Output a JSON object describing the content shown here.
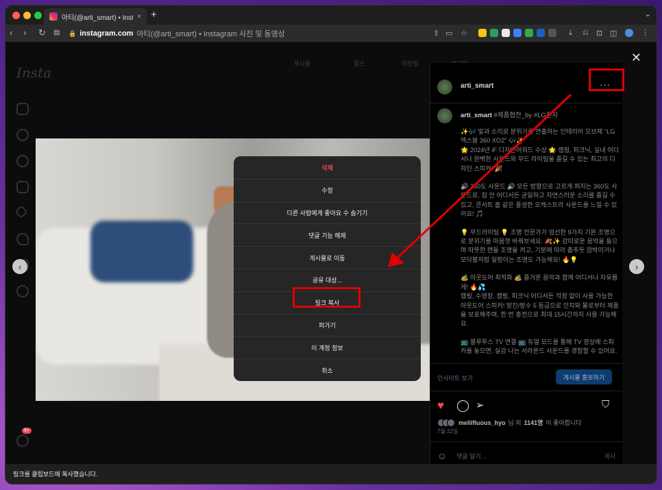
{
  "browser": {
    "tab_title": "아티(@arti_smart) • Instagram",
    "new_tab_label": "+",
    "url_domain": "instagram.com",
    "url_title": "아티(@arti_smart) • Instagram 사진 및 동영상"
  },
  "page": {
    "logo": "Insta",
    "top_tabs": [
      "게시물",
      "릴스",
      "저장됨",
      "태그됨"
    ],
    "notification_count": "9+"
  },
  "post": {
    "author": "arti_smart",
    "more_label": "···",
    "caption_author": "arti_smart",
    "caption_tags": "#제품협찬_by #LG전자",
    "caption_paragraphs": [
      "✨🎶 빛과 소리로 분위기를 연출하는 인테리어 오브제 \"LG 엑스붐 360 XO2\" 🎶✨\n🌟 2024년 iF 디자인어워드 수상 🌟 캠핑, 피크닉, 실내 어디서나 완벽한 사운드와 무드 라이팅을 즐길 수 있는 최고의 디자인 스피커! 🎉",
      "🔊 360도 사운드 🔊 모든 방향으로 고르게 퍼지는 360도 사운드로, 집 안 어디서든 균일하고 자연스러운 소리를 즐길 수 있고, 콘서트 홀 같은 풍성한 오케스트라 사운드를 느낄 수 있어요! 🎵",
      "💡 무드라이팅 💡 조명 전문가가 엄선한 9가지 기본 조명으로 분위기를 마음껏 바꿔보세요. 🍂✨ 감미로운 음악을 들으며 따뜻한 캔들 조명을 켜고, 기분에 따라 춤추듯 깜박이거나 모닥불처럼 일렁이는 조명도 가능해요! 🔥💡",
      "🏕️ 아웃도어 최적화 🏕️ 즐거운 음악과 함께 어디서나 자유롭게! 🔥💦\n캠핑, 수영장, 캠핑, 피크닉 어디서든 걱정 없이 사용 가능한 아웃도어 스피커! 방진/방수 5 등급으로 인지와 물로부터 제품을 보호해주며, 한 번 충전으로 최대 15시간까지 사용 가능해요.",
      "📺 블루투스 TV 연결 📺 듀얼 모드를 통해 TV 영상에 스피커를 놓으면, 실감 나는 서라운드 사운드를 경험할 수 있어요. 마치 처음부터 한 쌍의 스피커였던 것처럼 놀라운 싱크로율로 몰입감 넘치는 사운드를 즐겨보세요!"
    ],
    "insights_label": "인사이트 보기",
    "promote_label": "게시물 홍보하기",
    "likes_user": "mellifluous_hyo",
    "likes_suffix": "님 외",
    "likes_count": "1141명",
    "likes_tail": "이 좋아합니다",
    "date": "7월 22일",
    "comment_placeholder": "댓글 달기...",
    "comment_post": "게시"
  },
  "modal": {
    "items": [
      {
        "label": "삭제",
        "danger": true
      },
      {
        "label": "수정"
      },
      {
        "label": "다른 사람에게 좋아요 수 숨기기"
      },
      {
        "label": "댓글 기능 해제"
      },
      {
        "label": "게시물로 이동"
      },
      {
        "label": "공유 대상..."
      },
      {
        "label": "링크 복사",
        "highlighted": true
      },
      {
        "label": "퍼가기"
      },
      {
        "label": "이 계정 정보"
      },
      {
        "label": "취소"
      }
    ]
  },
  "toast": {
    "message": "링크를 클립보드에 복사했습니다."
  },
  "colors": {
    "annotation_red": "#e00000",
    "danger": "#ed4956",
    "heart": "#ed4956"
  }
}
